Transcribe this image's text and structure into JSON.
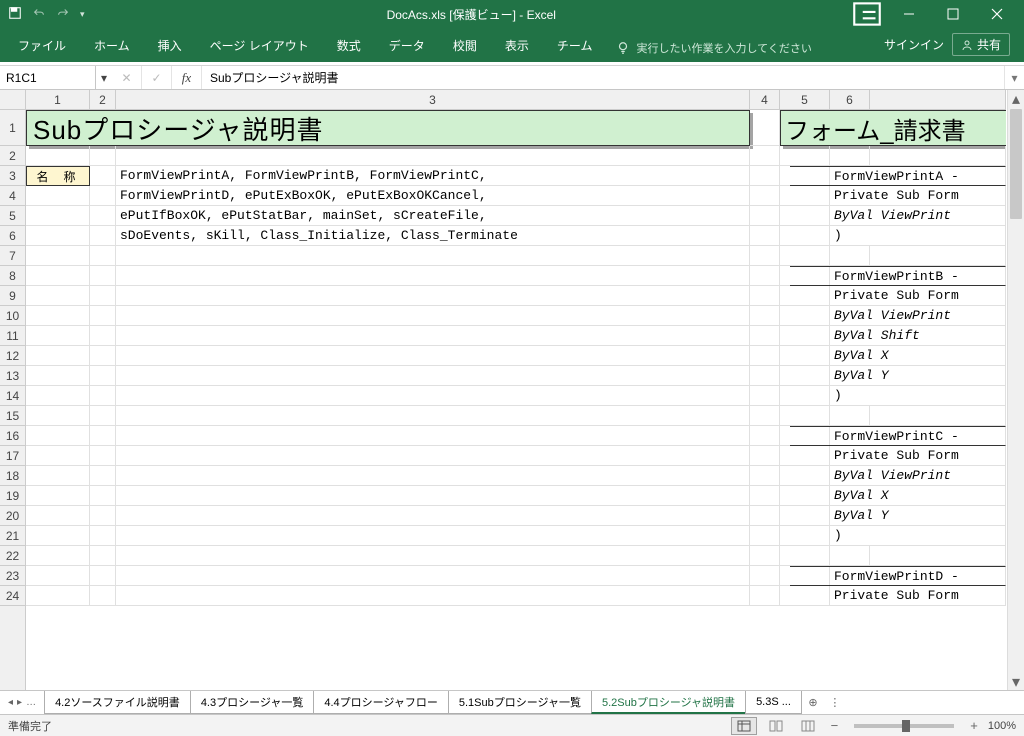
{
  "title": "DocAcs.xls  [保護ビュー] - Excel",
  "ribbon": {
    "tabs": [
      "ファイル",
      "ホーム",
      "挿入",
      "ページ レイアウト",
      "数式",
      "データ",
      "校閲",
      "表示",
      "チーム"
    ],
    "tell_me": "実行したい作業を入力してください",
    "signin": "サインイン",
    "share": "共有"
  },
  "formula": {
    "name_box": "R1C1",
    "content": "Subプロシージャ説明書"
  },
  "cols": [
    "1",
    "2",
    "3",
    "4",
    "5",
    "6"
  ],
  "rows": [
    "1",
    "2",
    "3",
    "4",
    "5",
    "6",
    "7",
    "8",
    "9",
    "10",
    "11",
    "12",
    "13",
    "14",
    "15",
    "16",
    "17",
    "18",
    "19",
    "20",
    "21",
    "22",
    "23",
    "24"
  ],
  "sheet": {
    "title_a": "Subプロシージャ説明書",
    "title_b": "フォーム_請求書",
    "label_row3": "名 称",
    "left_lines": [
      "FormViewPrintA, FormViewPrintB, FormViewPrintC,",
      "FormViewPrintD, ePutExBoxOK, ePutExBoxOKCancel,",
      "ePutIfBoxOK, ePutStatBar, mainSet, sCreateFile,",
      "sDoEvents, sKill, Class_Initialize, Class_Terminate"
    ],
    "right_lines": {
      "r3": "FormViewPrintA -",
      "r4": "Private Sub Form",
      "r5": "  ByVal ViewPrint",
      "r6": ")",
      "r8": "FormViewPrintB -",
      "r9": "Private Sub Form",
      "r10": "  ByVal ViewPrint",
      "r11": "  ByVal Shift",
      "r12": "  ByVal X",
      "r13": "  ByVal Y",
      "r14": ")",
      "r16": "FormViewPrintC -",
      "r17": "Private Sub Form",
      "r18": "  ByVal ViewPrint",
      "r19": "  ByVal X",
      "r20": "  ByVal Y",
      "r21": ")",
      "r23": "FormViewPrintD -",
      "r24": "Private Sub Form"
    }
  },
  "tabs": {
    "items": [
      "4.2ソースファイル説明書",
      "4.3プロシージャ一覧",
      "4.4プロシージャフロー",
      "5.1Subプロシージャ一覧",
      "5.2Subプロシージャ説明書",
      "5.3S ..."
    ],
    "active": "5.2Subプロシージャ説明書"
  },
  "status": {
    "ready": "準備完了",
    "zoom": "100%"
  }
}
